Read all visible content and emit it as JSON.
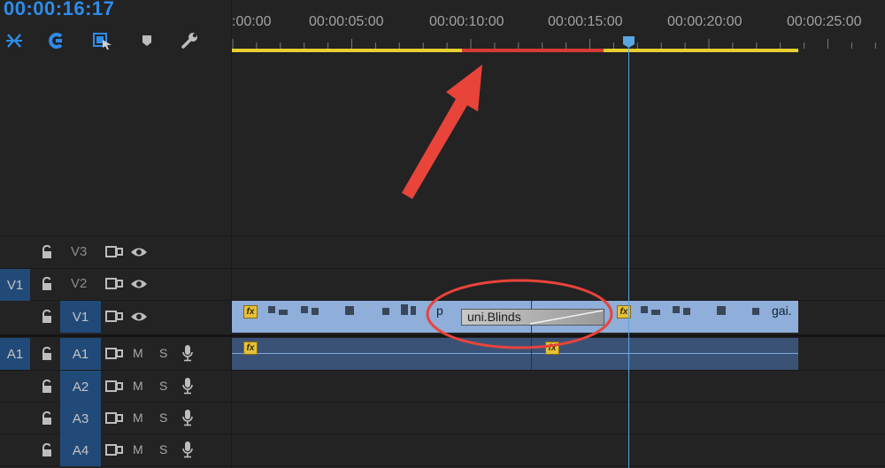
{
  "timecode": "00:00:16:17",
  "ruler": {
    "labels": [
      ":00:00",
      "00:00:05:00",
      "00:00:10:00",
      "00:00:15:00",
      "00:00:20:00",
      "00:00:25:00"
    ]
  },
  "toolbar": {
    "icons": [
      "snap-icon",
      "linked-selection-icon",
      "add-marker-icon",
      "marker-icon",
      "wrench-icon"
    ]
  },
  "tracks": {
    "video": [
      {
        "name": "V3",
        "source": "",
        "targeted": false
      },
      {
        "name": "V2",
        "source": "V1",
        "targeted": false
      },
      {
        "name": "V1",
        "source": "",
        "targeted": true
      }
    ],
    "audio": [
      {
        "name": "A1",
        "source": "A1",
        "targeted": true,
        "mute": "M",
        "solo": "S"
      },
      {
        "name": "A2",
        "source": "",
        "targeted": true,
        "mute": "M",
        "solo": "S"
      },
      {
        "name": "A3",
        "source": "",
        "targeted": true,
        "mute": "M",
        "solo": "S"
      },
      {
        "name": "A4",
        "source": "",
        "targeted": true,
        "mute": "M",
        "solo": "S"
      }
    ]
  },
  "clips": {
    "video_left_suffix": "p",
    "video_right_suffix": "gai.",
    "fx_badge": "fx"
  },
  "transition": {
    "label": "uni.Blinds"
  },
  "colors": {
    "timecode": "#2d8ceb",
    "work_area": "#e6cf2e",
    "render_bar": "#d83a32",
    "playhead": "#5aa6de",
    "video_clip": "#8faed9",
    "audio_clip": "#3b5277",
    "track_target": "#214a79",
    "annotation": "#e8443a"
  }
}
